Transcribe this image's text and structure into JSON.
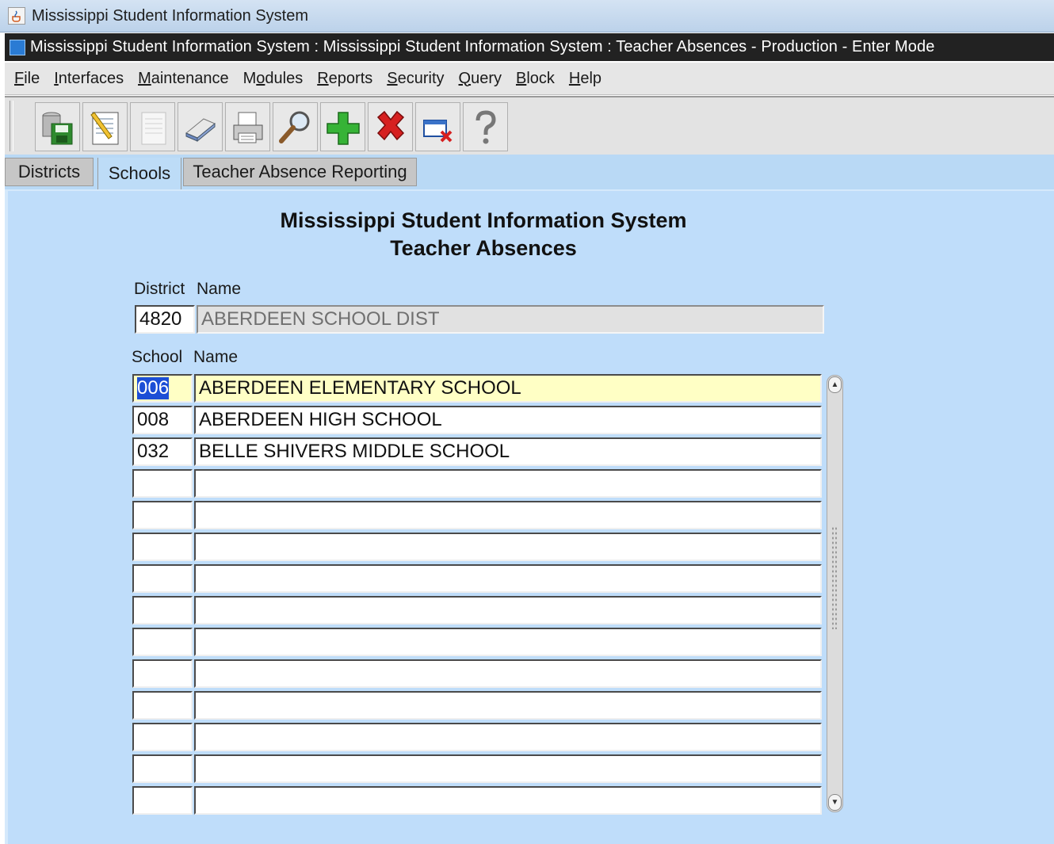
{
  "window": {
    "title": "Mississippi Student Information System"
  },
  "form": {
    "title": "Mississippi Student Information System : Mississippi Student Information System : Teacher Absences  -  Production  -  Enter Mode"
  },
  "menu": [
    {
      "mn": "F",
      "rest": "ile"
    },
    {
      "mn": "I",
      "rest": "nterfaces"
    },
    {
      "mn": "M",
      "rest": "aintenance"
    },
    {
      "pre": "M",
      "mn": "o",
      "rest": "dules"
    },
    {
      "mn": "R",
      "rest": "eports"
    },
    {
      "mn": "S",
      "rest": "ecurity"
    },
    {
      "mn": "Q",
      "rest": "uery"
    },
    {
      "mn": "B",
      "rest": "lock"
    },
    {
      "mn": "H",
      "rest": "elp"
    }
  ],
  "toolbar": {
    "icons": [
      "save-icon",
      "edit-icon",
      "blank-page-icon",
      "eraser-icon",
      "print-icon",
      "search-icon",
      "add-icon",
      "delete-icon",
      "exit-icon",
      "help-icon"
    ]
  },
  "tabs": [
    "Districts",
    "Schools",
    "Teacher Absence Reporting"
  ],
  "active_tab": "Schools",
  "main": {
    "heading1": "Mississippi Student Information System",
    "heading2": "Teacher Absences",
    "district_label_code": "District",
    "district_label_name": "Name",
    "district_code": "4820",
    "district_name": "ABERDEEN SCHOOL DIST",
    "school_label_code": "School",
    "school_label_name": "Name",
    "schools": [
      {
        "code": "006",
        "name": "ABERDEEN ELEMENTARY SCHOOL"
      },
      {
        "code": "008",
        "name": "ABERDEEN HIGH SCHOOL"
      },
      {
        "code": "032",
        "name": "BELLE SHIVERS MIDDLE SCHOOL"
      },
      {
        "code": "",
        "name": ""
      },
      {
        "code": "",
        "name": ""
      },
      {
        "code": "",
        "name": ""
      },
      {
        "code": "",
        "name": ""
      },
      {
        "code": "",
        "name": ""
      },
      {
        "code": "",
        "name": ""
      },
      {
        "code": "",
        "name": ""
      },
      {
        "code": "",
        "name": ""
      },
      {
        "code": "",
        "name": ""
      },
      {
        "code": "",
        "name": ""
      },
      {
        "code": "",
        "name": ""
      }
    ]
  }
}
